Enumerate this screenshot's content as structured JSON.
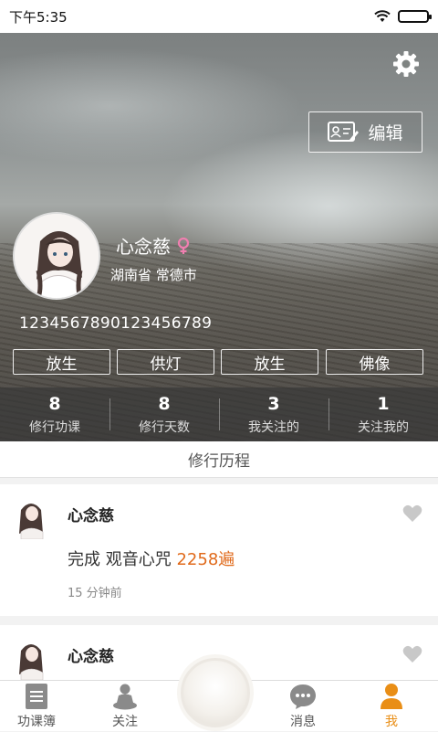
{
  "status_bar": {
    "time": "下午5:35",
    "wifi_icon": "wifi-icon",
    "battery_icon": "battery-icon"
  },
  "profile": {
    "settings_icon": "gear-icon",
    "edit_label": "编辑",
    "name": "心念慈",
    "gender_icon": "female-icon",
    "location": "湖南省 常德市",
    "uid": "1234567890123456789",
    "tags": [
      "放生",
      "供灯",
      "放生",
      "佛像"
    ],
    "stats": [
      {
        "value": "8",
        "label": "修行功课"
      },
      {
        "value": "8",
        "label": "修行天数"
      },
      {
        "value": "3",
        "label": "我关注的"
      },
      {
        "value": "1",
        "label": "关注我的"
      }
    ]
  },
  "section_title": "修行历程",
  "feed": [
    {
      "name": "心念慈",
      "content_prefix": "完成 观音心咒",
      "count": "2258遍",
      "time": "15 分钟前"
    },
    {
      "name": "心念慈"
    }
  ],
  "tabbar": {
    "tabs": [
      {
        "label": "功课簿",
        "icon": "book-icon"
      },
      {
        "label": "关注",
        "icon": "meditation-icon"
      },
      {
        "label": "消息",
        "icon": "message-icon"
      },
      {
        "label": "我",
        "icon": "person-icon"
      }
    ],
    "active": "我"
  },
  "colors": {
    "accent": "#e98e16",
    "count": "#e06a1b",
    "female": "#f07fb0"
  }
}
